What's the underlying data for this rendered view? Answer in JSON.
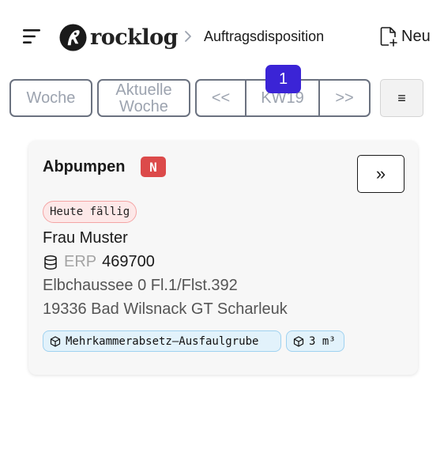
{
  "header": {
    "brand": "rocklog",
    "breadcrumb": "Auftragsdisposition",
    "new_label": "Neu"
  },
  "week_nav": {
    "woche_label": "Woche",
    "aktuelle_label": "Aktuelle Woche",
    "prev_label": "<<",
    "week_label": "KW19",
    "next_label": ">>",
    "badge_count": "1",
    "list_label": "≡"
  },
  "order": {
    "title": "Abpumpen",
    "tag": "N",
    "open_label": "»",
    "due": "Heute fällig",
    "customer": "Frau Muster",
    "erp_label": "ERP",
    "erp_number": "469700",
    "address_line1": "Elbchaussee 0 Fl.1/Flst.392",
    "address_line2": "19336 Bad Wilsnack GT Scharleuk",
    "chips": [
      {
        "icon": "cube-icon",
        "label": "Mehrkammerabsetz–Ausfaulgrube"
      },
      {
        "icon": "cube-icon",
        "label": "3 m³"
      }
    ]
  },
  "colors": {
    "badge": "#3b24d6",
    "tag_new": "#dc4a4a",
    "due_bg": "#fde8e8",
    "chip_bg": "#e2f2fb"
  }
}
